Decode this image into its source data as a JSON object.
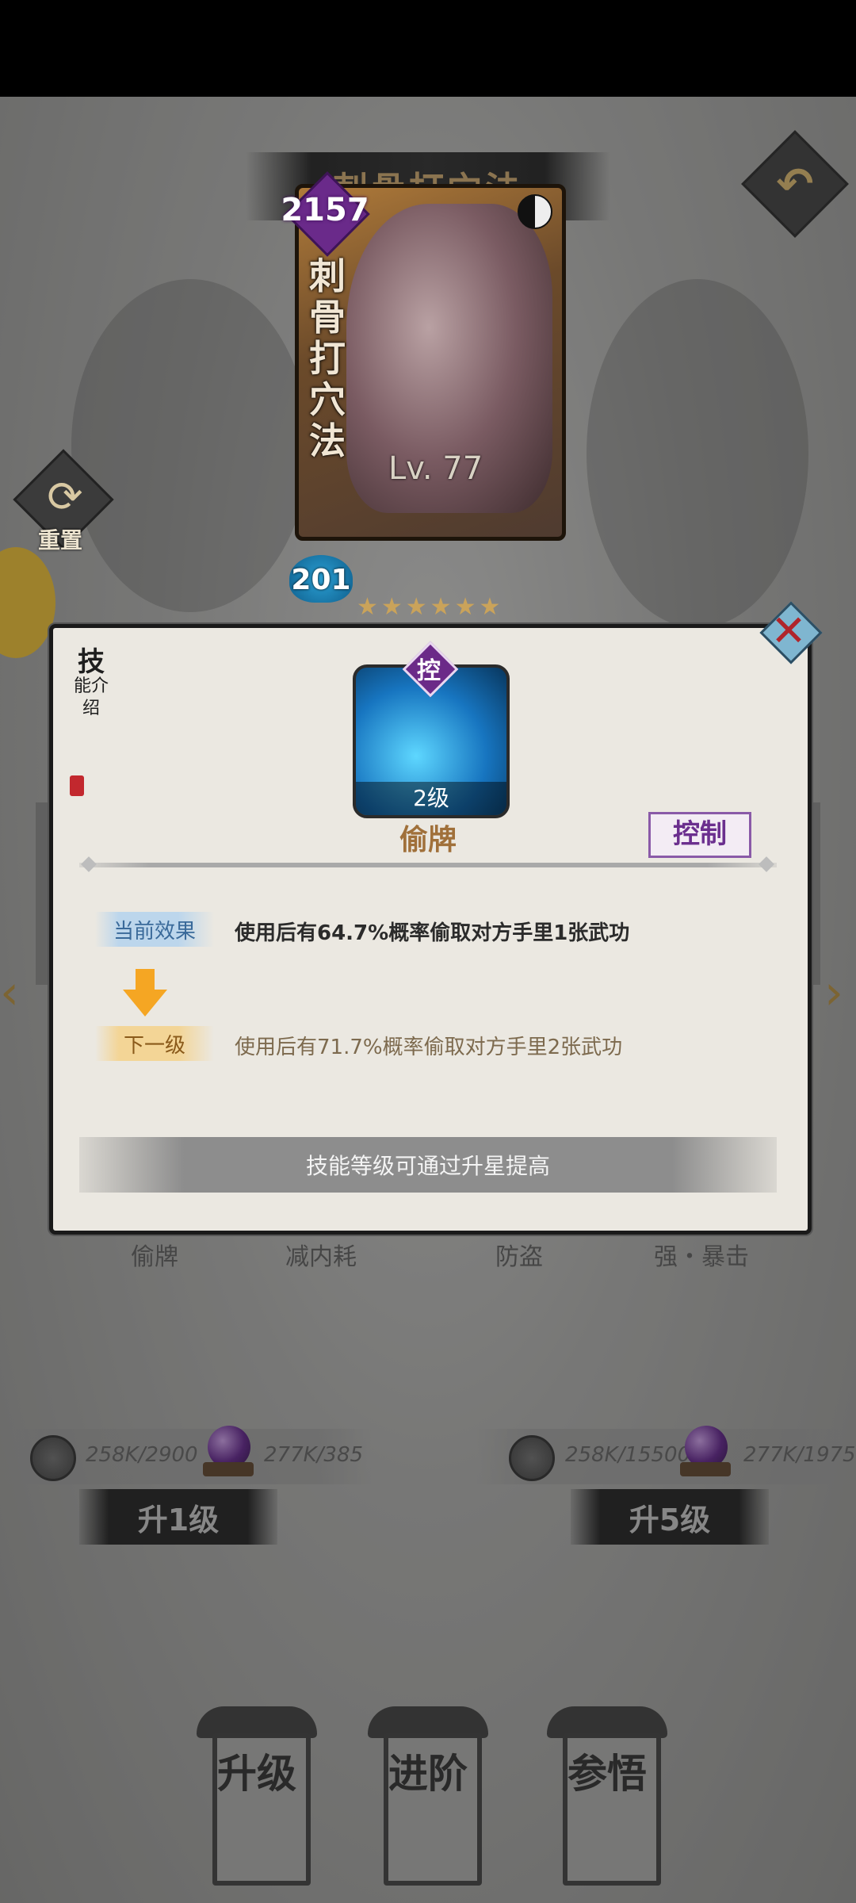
{
  "header": {
    "title": "刺骨打穴法"
  },
  "card": {
    "name": "刺骨打穴法",
    "power": "2157",
    "level": "Lv. 77",
    "mp": "201",
    "stars": "★★★★★★"
  },
  "side": {
    "reset_label": "重置"
  },
  "skills_row": [
    "偷牌",
    "减内耗",
    "防盗",
    "强・暴击"
  ],
  "upgrade": {
    "left": {
      "coin": "258K/2900",
      "orb": "277K/385",
      "button": "升1级"
    },
    "right": {
      "coin": "258K/15500",
      "orb": "277K/1975",
      "button": "升5级"
    }
  },
  "bottom_nav": [
    {
      "label": "升级"
    },
    {
      "label": "进阶"
    },
    {
      "label": "参悟"
    }
  ],
  "modal": {
    "side_caption_big": "技",
    "side_caption_small": "能介绍",
    "skill_tag": "控",
    "skill_level": "2级",
    "skill_name": "偷牌",
    "type_badge": "控制",
    "current_label": "当前效果",
    "current_text": "使用后有64.7%概率偷取对方手里1张武功",
    "next_label": "下一级",
    "next_text": "使用后有71.7%概率偷取对方手里2张武功",
    "hint": "技能等级可通过升星提高",
    "close_symbol": "✕"
  },
  "colors": {
    "title_gold": "#c9a46a",
    "skill_name": "#a0703a",
    "type_purple": "#6b2f8e",
    "arrow_orange": "#f5a623"
  },
  "icons": {
    "back": "return-arrow-icon",
    "reset": "refresh-icon",
    "close": "close-icon",
    "coin": "coin-icon",
    "orb": "purple-orb-icon"
  }
}
